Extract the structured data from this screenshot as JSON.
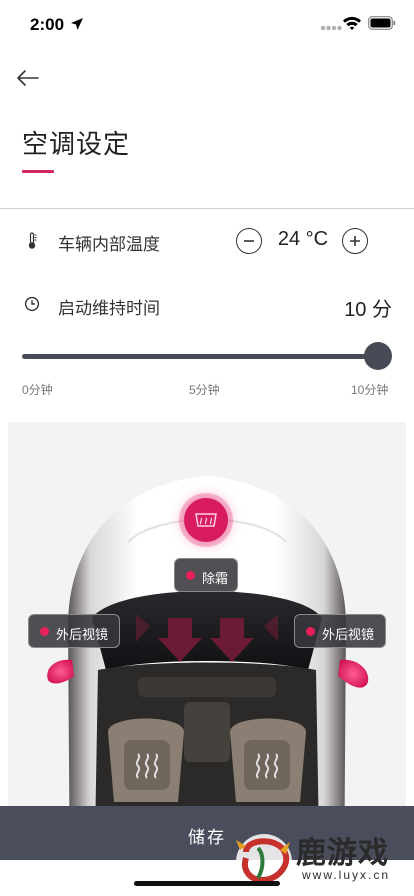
{
  "status_bar": {
    "time": "2:00",
    "icons": [
      "location-arrow-icon",
      "signal-dots-icon",
      "wifi-icon",
      "battery-icon"
    ]
  },
  "header": {
    "back_icon": "arrow-left-icon",
    "title": "空调设定",
    "accent_color": "#d22860"
  },
  "settings": {
    "temperature": {
      "icon": "thermometer-icon",
      "label": "车辆内部温度",
      "value": "24 °C",
      "decrease_icon": "minus-circle-icon",
      "increase_icon": "plus-circle-icon"
    },
    "duration": {
      "icon": "clock-icon",
      "label": "启动维持时间",
      "value": "10 分",
      "slider": {
        "min_label": "0分钟",
        "mid_label": "5分钟",
        "max_label": "10分钟",
        "level": 1.0
      }
    }
  },
  "car": {
    "defrost_icon": "rear-defrost-icon",
    "toggles": [
      {
        "label": "除霜",
        "active": true
      },
      {
        "label": "外后视镜",
        "side": "left",
        "active": true
      },
      {
        "label": "外后视镜",
        "side": "right",
        "active": true
      }
    ],
    "seat_icon": "seat-heat-icon",
    "active_color": "#e8205a"
  },
  "save_button": {
    "label": "储存",
    "color": "#4a4d5c"
  },
  "watermark": {
    "text": "鹿游戏",
    "url": "www.luyx.cn"
  }
}
